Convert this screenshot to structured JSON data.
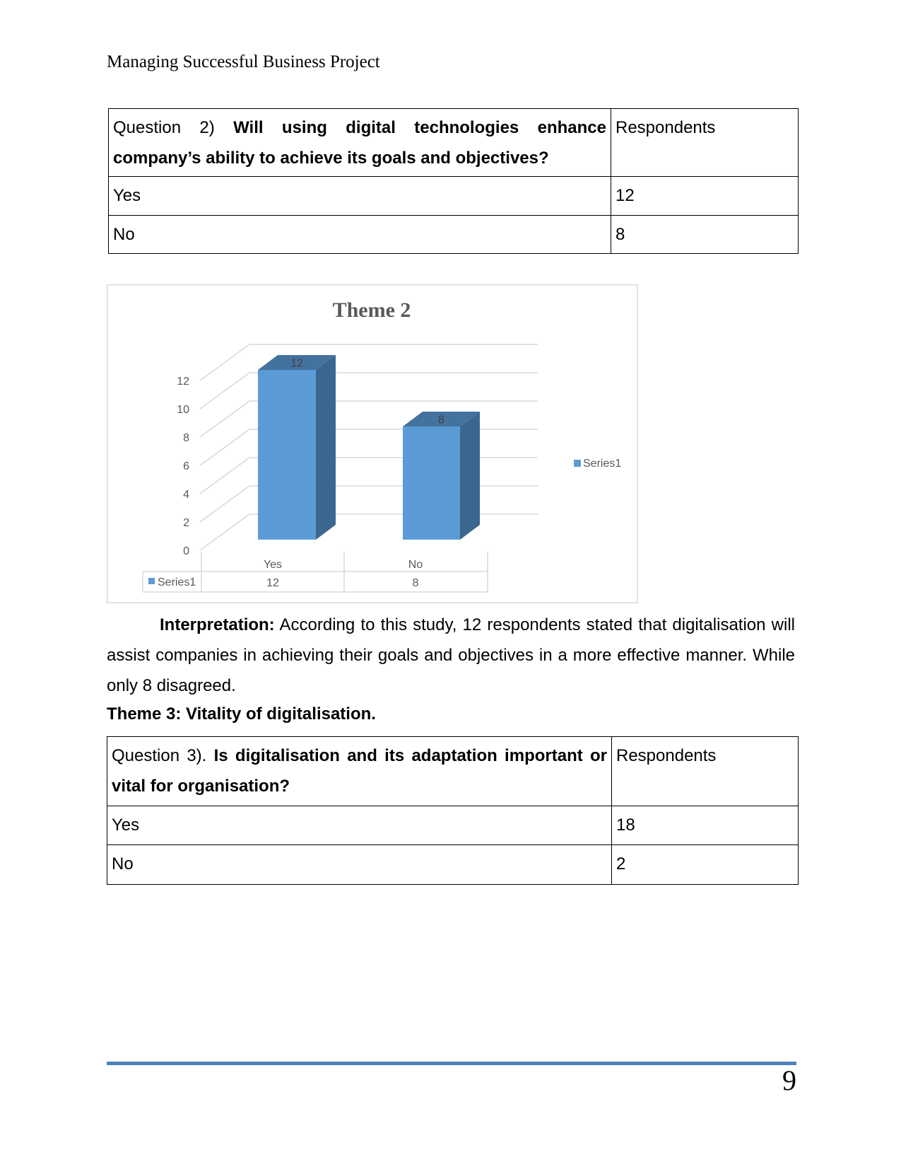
{
  "header": {
    "title": "Managing Successful Business Project"
  },
  "table1": {
    "question_prefix": "Question 2) ",
    "question_bold": "Will using digital technologies enhance company’s ability to achieve its goals and objectives?",
    "col2_header": "Respondents",
    "rows": [
      {
        "label": "Yes",
        "value": "12"
      },
      {
        "label": "No",
        "value": "8"
      }
    ]
  },
  "chart_data": {
    "type": "bar",
    "style": "3d-column with data table",
    "title": "Theme 2",
    "categories": [
      "Yes",
      "No"
    ],
    "series": [
      {
        "name": "Series1",
        "values": [
          12,
          8
        ]
      }
    ],
    "ylim": [
      0,
      12
    ],
    "yticks": [
      "0",
      "2",
      "4",
      "6",
      "8",
      "10",
      "12"
    ],
    "data_labels": [
      "12",
      "8"
    ],
    "grid": true,
    "legend": "right",
    "colors": {
      "bar_front": "#5b9bd5",
      "bar_side": "#3b6690",
      "bar_top": "#44729e",
      "grid": "#d9d9d9",
      "text": "#595959"
    }
  },
  "interpretation": {
    "label": "Interpretation:",
    "text": " According to this study, 12 respondents stated that digitalisation will assist companies in achieving their goals and objectives in a more effective manner. While only 8 disagreed."
  },
  "theme3": {
    "heading": "Theme 3: Vitality of digitalisation."
  },
  "table2": {
    "question_prefix": "Question 3). ",
    "question_bold": "Is digitalisation and its adaptation important or vital for organisation?",
    "col2_header": "Respondents",
    "rows": [
      {
        "label": "Yes",
        "value": "18"
      },
      {
        "label": "No",
        "value": "2"
      }
    ]
  },
  "footer": {
    "page_number": "9",
    "rule_color": "#4f81bd"
  }
}
